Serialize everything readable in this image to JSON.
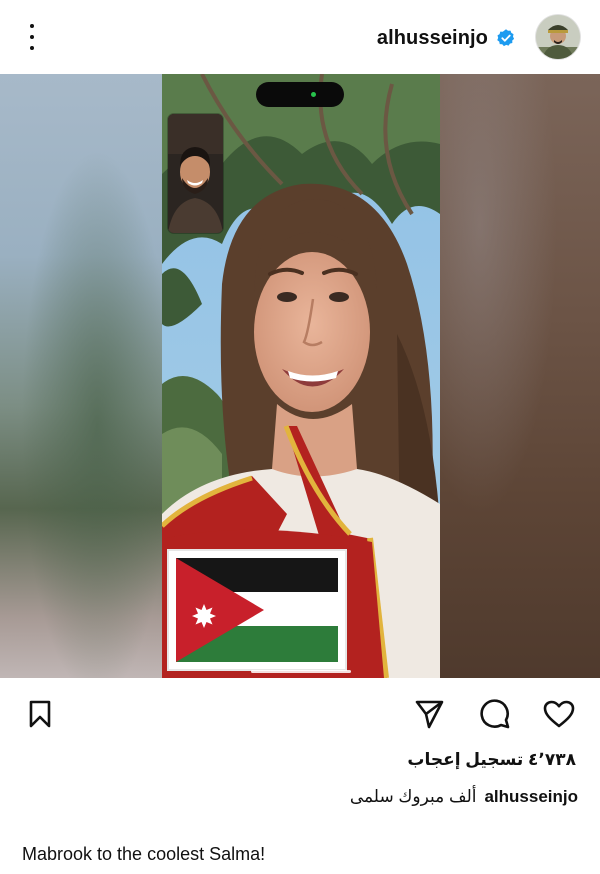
{
  "header": {
    "username": "alhusseinjo",
    "verified": true,
    "menu_icon": "kebab-menu-icon",
    "verified_icon": "verified-badge-icon"
  },
  "media": {
    "type": "video-call-screenshot",
    "call_indicator_color": "#27c24c"
  },
  "actions": {
    "icons": [
      "bookmark-icon",
      "share-icon",
      "comment-icon",
      "heart-icon"
    ]
  },
  "post": {
    "likes_text": "٤٬٧٣٨ تسجيل إعجاب",
    "caption_user": "alhusseinjo",
    "caption_text": "ألف مبروك سلمى",
    "caption_english": "Mabrook to the coolest Salma!"
  },
  "colors": {
    "verified_badge": "#1d9bf0",
    "text": "#111111",
    "background": "#ffffff"
  }
}
